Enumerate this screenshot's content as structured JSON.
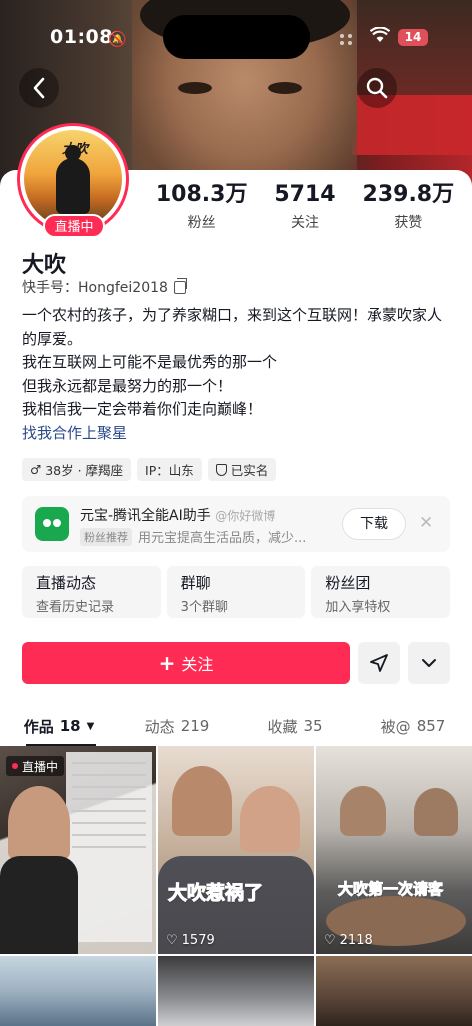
{
  "status_bar": {
    "time": "01:08",
    "battery": "14",
    "battery_color": "#e0505a"
  },
  "header": {
    "back_icon": "chevron-left-icon",
    "search_icon": "search-icon"
  },
  "profile": {
    "live_label": "直播中",
    "avatar_signature": "大吹",
    "name": "大吹",
    "uid": "快手号：Hongfei2018",
    "stats": [
      {
        "value": "108.3万",
        "label": "粉丝"
      },
      {
        "value": "5714",
        "label": "关注"
      },
      {
        "value": "239.8万",
        "label": "获赞"
      }
    ],
    "bio_lines": [
      "一个农村的孩子，为了养家糊口，来到这个互联网！承蒙吹家人的厚爱。",
      "我在互联网上可能不是最优秀的那一个",
      "但我永远都是最努力的那一个！",
      "我相信我一定会带着你们走向巅峰！"
    ],
    "bio_link": "找我合作上聚星",
    "tags": [
      {
        "text": "38岁 · 摩羯座",
        "icon": "male-icon"
      },
      {
        "text": "IP：山东",
        "icon": ""
      },
      {
        "text": "已实名",
        "icon": "shield-icon"
      }
    ]
  },
  "promo": {
    "title": "元宝-腾讯全能AI助手",
    "watermark": "@你好微博",
    "badge": "粉丝推荐",
    "desc": "用元宝提高生活品质，减少...",
    "download_label": "下载",
    "close_icon": "close-icon"
  },
  "features": [
    {
      "title": "直播动态",
      "sub": "查看历史记录"
    },
    {
      "title": "群聊",
      "sub": "3个群聊"
    },
    {
      "title": "粉丝团",
      "sub": "加入享特权"
    }
  ],
  "actions": {
    "follow_label": "关注",
    "share_icon": "send-icon",
    "more_icon": "chevron-down-icon"
  },
  "tabs": [
    {
      "label": "作品",
      "count": "18"
    },
    {
      "label": "动态",
      "count": "219"
    },
    {
      "label": "收藏",
      "count": "35"
    },
    {
      "label": "被@",
      "count": "857"
    }
  ],
  "grid": [
    {
      "live": "直播中",
      "likes": "",
      "caption": ""
    },
    {
      "live": "",
      "likes": "1579",
      "caption": "大吹惹祸了"
    },
    {
      "live": "",
      "likes": "2118",
      "caption": "大吹第一次请客"
    },
    {
      "live": "",
      "likes": "",
      "caption": ""
    },
    {
      "live": "",
      "likes": "",
      "caption": ""
    },
    {
      "live": "",
      "likes": "",
      "caption": ""
    }
  ],
  "colors": {
    "accent": "#fe2c55",
    "link": "#2a4a8c"
  }
}
